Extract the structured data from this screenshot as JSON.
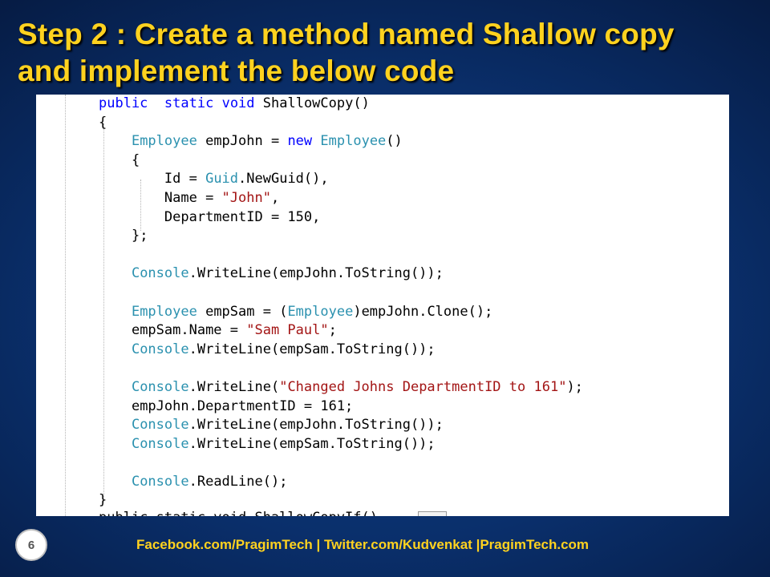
{
  "slide": {
    "title_line1": "Step 2 : Create a method named Shallow copy",
    "title_line2": "and implement the below code",
    "page_number": "6",
    "footer": "Facebook.com/PragimTech  | Twitter.com/Kudvenkat  |PragimTech.com"
  },
  "code": {
    "lines": [
      {
        "indent": 0,
        "tokens": [
          [
            "kw",
            "public"
          ],
          [
            "",
            "  "
          ],
          [
            "kw",
            "static"
          ],
          [
            "",
            " "
          ],
          [
            "kw",
            "void"
          ],
          [
            "",
            " ShallowCopy()"
          ]
        ]
      },
      {
        "indent": 0,
        "tokens": [
          [
            "",
            "{"
          ]
        ]
      },
      {
        "indent": 1,
        "tokens": [
          [
            "ty",
            "Employee"
          ],
          [
            "",
            " empJohn = "
          ],
          [
            "kw",
            "new"
          ],
          [
            "",
            " "
          ],
          [
            "ty",
            "Employee"
          ],
          [
            "",
            "()"
          ]
        ]
      },
      {
        "indent": 1,
        "tokens": [
          [
            "",
            "{"
          ]
        ]
      },
      {
        "indent": 2,
        "tokens": [
          [
            "",
            "Id = "
          ],
          [
            "ty",
            "Guid"
          ],
          [
            "",
            ".NewGuid(),"
          ]
        ]
      },
      {
        "indent": 2,
        "tokens": [
          [
            "",
            "Name = "
          ],
          [
            "str",
            "\"John\""
          ],
          [
            "",
            ","
          ]
        ]
      },
      {
        "indent": 2,
        "tokens": [
          [
            "",
            "DepartmentID = 150,"
          ]
        ]
      },
      {
        "indent": 1,
        "tokens": [
          [
            "",
            "};"
          ]
        ]
      },
      {
        "indent": 0,
        "tokens": []
      },
      {
        "indent": 1,
        "tokens": [
          [
            "ty",
            "Console"
          ],
          [
            "",
            ".WriteLine(empJohn.ToString());"
          ]
        ]
      },
      {
        "indent": 0,
        "tokens": []
      },
      {
        "indent": 1,
        "tokens": [
          [
            "ty",
            "Employee"
          ],
          [
            "",
            " empSam = ("
          ],
          [
            "ty",
            "Employee"
          ],
          [
            "",
            ")empJohn.Clone();"
          ]
        ]
      },
      {
        "indent": 1,
        "tokens": [
          [
            "",
            "empSam.Name = "
          ],
          [
            "str",
            "\"Sam Paul\""
          ],
          [
            "",
            ";"
          ]
        ]
      },
      {
        "indent": 1,
        "tokens": [
          [
            "ty",
            "Console"
          ],
          [
            "",
            ".WriteLine(empSam.ToString());"
          ]
        ]
      },
      {
        "indent": 0,
        "tokens": []
      },
      {
        "indent": 1,
        "tokens": [
          [
            "ty",
            "Console"
          ],
          [
            "",
            ".WriteLine("
          ],
          [
            "str",
            "\"Changed Johns DepartmentID to 161\""
          ],
          [
            "",
            ");"
          ]
        ]
      },
      {
        "indent": 1,
        "tokens": [
          [
            "",
            "empJohn.DepartmentID = 161;"
          ]
        ]
      },
      {
        "indent": 1,
        "tokens": [
          [
            "ty",
            "Console"
          ],
          [
            "",
            ".WriteLine(empJohn.ToString());"
          ]
        ]
      },
      {
        "indent": 1,
        "tokens": [
          [
            "ty",
            "Console"
          ],
          [
            "",
            ".WriteLine(empSam.ToString());"
          ]
        ]
      },
      {
        "indent": 0,
        "tokens": []
      },
      {
        "indent": 1,
        "tokens": [
          [
            "ty",
            "Console"
          ],
          [
            "",
            ".ReadLine();"
          ]
        ]
      },
      {
        "indent": 0,
        "tokens": [
          [
            "",
            "}"
          ]
        ]
      }
    ],
    "cut_line": "public static void ShallowCopyIf()"
  },
  "colors": {
    "title": "#ffd21f",
    "keyword": "#0000ff",
    "type": "#2b91af",
    "string": "#a31515"
  }
}
